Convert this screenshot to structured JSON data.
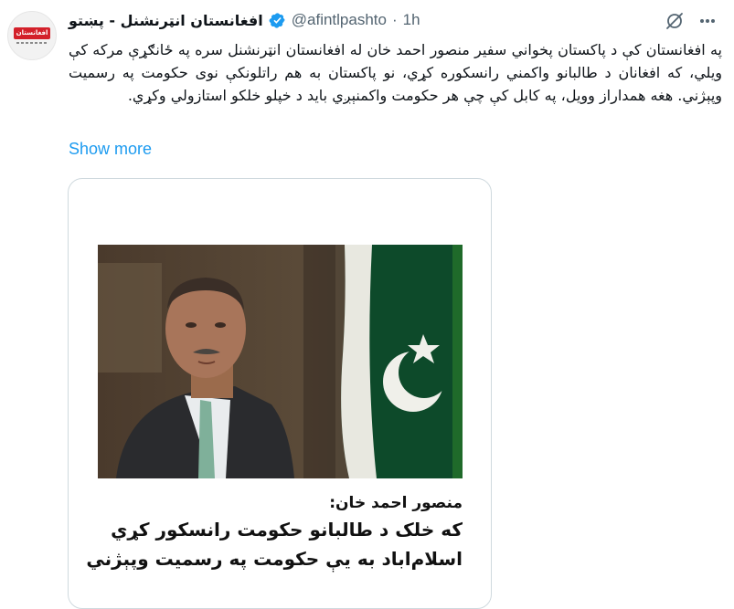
{
  "account": {
    "display_name": "افغانستان انټرنشنل - پښتو",
    "handle": "@afintlpashto",
    "separator": "·",
    "time": "1h",
    "avatar_logo_text": "افغانستان"
  },
  "tweet": {
    "text": "په افغانستان کې د پاکستان پخواني سفير منصور احمد خان له افغانستان انټرنشنل سره په ځانګړې مرکه کې ويلي، که افغانان د طالبانو واکمني رانسکوره کړي، نو پاکستان به هم راتلونکې نوی حکومت په رسميت وپېژني. هغه همداراز وويل، په کابل کې چې هر حکومت واکمنېږي بايد د خپلو خلکو استازولي وکړي.",
    "show_more": "Show more"
  },
  "card": {
    "caption_title": "منصور احمد خان:",
    "caption_line1": "که خلک د طالبانو حکومت رانسکور کړي",
    "caption_line2": "اسلام‌اباد به يې حکومت په رسميت وپېژني"
  },
  "icons": {
    "verified": "verified-badge-icon",
    "grok": "grok-icon",
    "more": "more-icon"
  },
  "colors": {
    "link": "#1d9bf0",
    "verified": "#1d9bf0",
    "secondary_text": "#536471",
    "brand_red": "#d3202a"
  }
}
